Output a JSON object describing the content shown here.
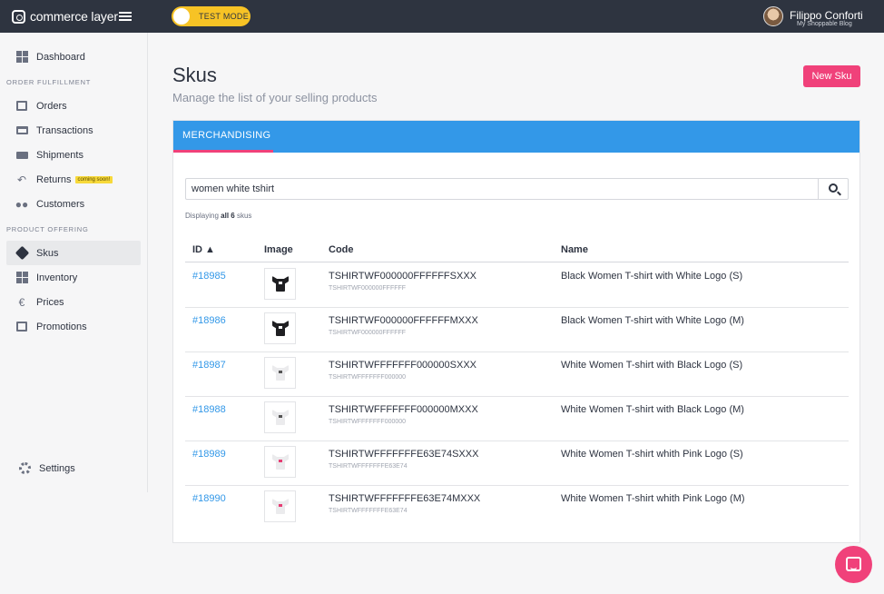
{
  "app": {
    "logo_text": "commerce layer",
    "test_mode_label": "TEST MODE",
    "user": {
      "name": "Filippo Conforti",
      "org": "My Shoppable Blog"
    }
  },
  "colors": {
    "accent": "#f0417a",
    "tab_blue": "#3398e8",
    "topbar": "#2e3440",
    "test_mode": "#f7c325"
  },
  "sidebar": {
    "dashboard": {
      "label": "Dashboard",
      "icon": "dashboard-icon"
    },
    "section_fulfillment": "ORDER FULFILLMENT",
    "fulfillment_items": [
      {
        "label": "Orders",
        "icon": "orders-icon"
      },
      {
        "label": "Transactions",
        "icon": "credit-card-icon"
      },
      {
        "label": "Shipments",
        "icon": "truck-icon"
      },
      {
        "label": "Returns",
        "icon": "undo-icon",
        "badge": "coming soon!"
      },
      {
        "label": "Customers",
        "icon": "users-icon"
      }
    ],
    "section_offering": "PRODUCT OFFERING",
    "offering_items": [
      {
        "label": "Skus",
        "icon": "tag-icon",
        "active": true
      },
      {
        "label": "Inventory",
        "icon": "grid-icon"
      },
      {
        "label": "Prices",
        "icon": "euro-icon"
      },
      {
        "label": "Promotions",
        "icon": "gift-icon"
      }
    ],
    "settings": {
      "label": "Settings",
      "icon": "gear-icon"
    }
  },
  "main": {
    "title": "Skus",
    "subtitle": "Manage the list of your selling products",
    "new_button": "New Sku",
    "tab": "MERCHANDISING",
    "search_value": "women white tshirt",
    "displaying_prefix": "Displaying",
    "displaying_count": "all 6",
    "displaying_suffix": "skus",
    "columns": {
      "id": "ID ▲",
      "image": "Image",
      "code": "Code",
      "name": "Name"
    },
    "rows": [
      {
        "id": "#18985",
        "code": "TSHIRTWF000000FFFFFFSXXX",
        "subcode": "TSHIRTWF000000FFFFFF",
        "name": "Black Women T-shirt with White Logo (S)",
        "shirt_color": "#1f1f22",
        "logo_color": "#ffffff"
      },
      {
        "id": "#18986",
        "code": "TSHIRTWF000000FFFFFFMXXX",
        "subcode": "TSHIRTWF000000FFFFFF",
        "name": "Black Women T-shirt with White Logo (M)",
        "shirt_color": "#1f1f22",
        "logo_color": "#ffffff"
      },
      {
        "id": "#18987",
        "code": "TSHIRTWFFFFFFF000000SXXX",
        "subcode": "TSHIRTWFFFFFFF000000",
        "name": "White Women T-shirt with Black Logo (S)",
        "shirt_color": "#ebebed",
        "logo_color": "#555555"
      },
      {
        "id": "#18988",
        "code": "TSHIRTWFFFFFFF000000MXXX",
        "subcode": "TSHIRTWFFFFFFF000000",
        "name": "White Women T-shirt with Black Logo (M)",
        "shirt_color": "#ebebed",
        "logo_color": "#555555"
      },
      {
        "id": "#18989",
        "code": "TSHIRTWFFFFFFFE63E74SXXX",
        "subcode": "TSHIRTWFFFFFFFE63E74",
        "name": "White Women T-shirt whith Pink Logo (S)",
        "shirt_color": "#ebebed",
        "logo_color": "#e63e74"
      },
      {
        "id": "#18990",
        "code": "TSHIRTWFFFFFFFE63E74MXXX",
        "subcode": "TSHIRTWFFFFFFFE63E74",
        "name": "White Women T-shirt whith Pink Logo (M)",
        "shirt_color": "#ebebed",
        "logo_color": "#e63e74"
      }
    ]
  },
  "chat": {
    "icon": "chat-icon"
  }
}
